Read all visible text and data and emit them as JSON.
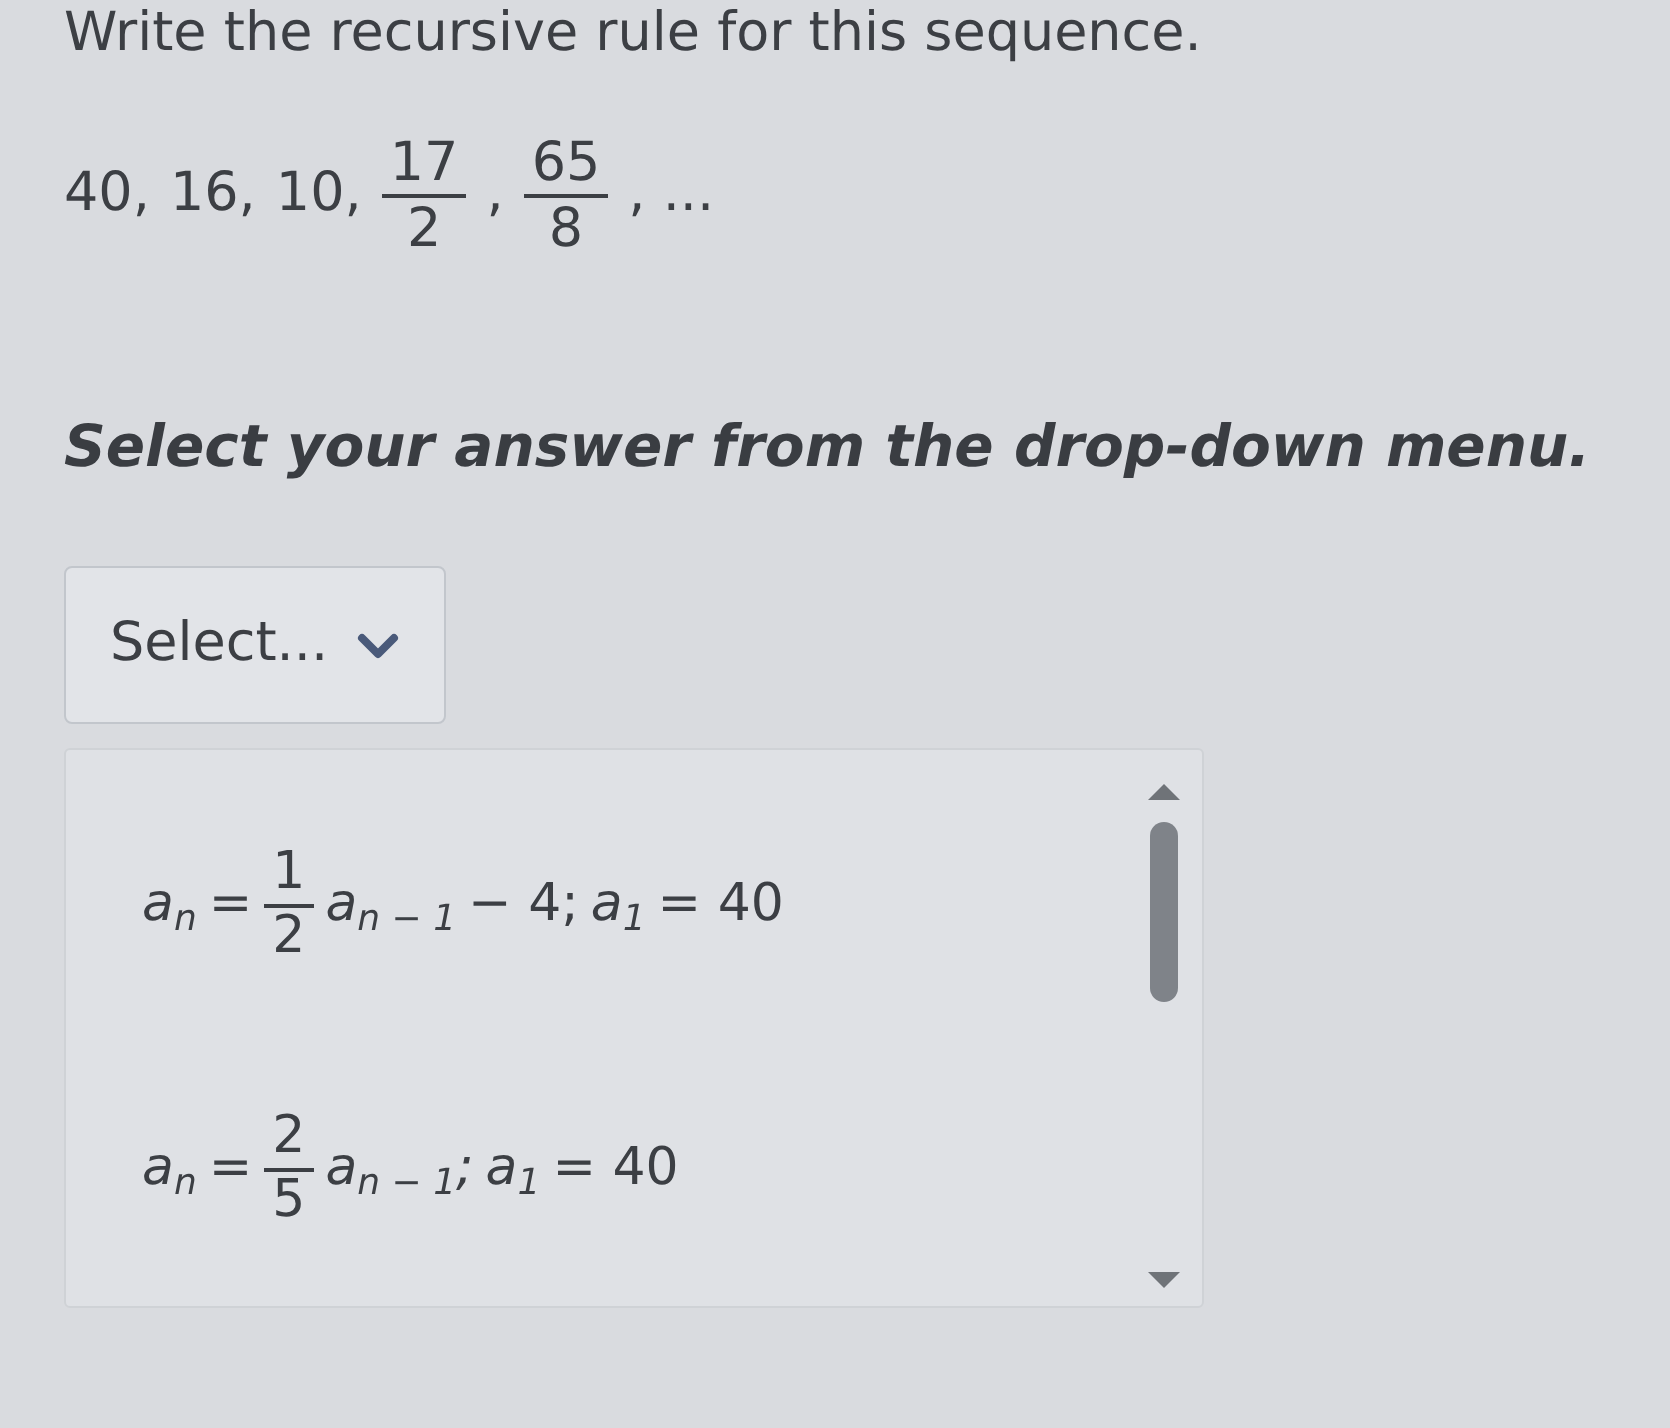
{
  "question": "Write the recursive rule for this sequence.",
  "sequence": [
    {
      "kind": "number",
      "text": "40,"
    },
    {
      "kind": "number",
      "text": "16,"
    },
    {
      "kind": "number",
      "text": "10,"
    },
    {
      "kind": "fraction",
      "numerator": "17",
      "denominator": "2"
    },
    {
      "kind": "number",
      "text": ","
    },
    {
      "kind": "fraction",
      "numerator": "65",
      "denominator": "8"
    },
    {
      "kind": "number",
      "text": ", ..."
    }
  ],
  "instruction": "Select your answer from the drop-down menu.",
  "dropdown": {
    "placeholder": "Select...",
    "expanded": true
  },
  "options": [
    {
      "selected": false,
      "parts": [
        {
          "kind": "var",
          "text": "a$_{n}$"
        },
        {
          "kind": "op",
          "text": "="
        },
        {
          "kind": "fraction",
          "numerator": "1",
          "denominator": "2"
        },
        {
          "kind": "var",
          "text": "a$_{n − 1}$"
        },
        {
          "kind": "op",
          "text": "− 4;"
        },
        {
          "kind": "var",
          "text": "a$_{1}$"
        },
        {
          "kind": "op",
          "text": "= 40"
        }
      ]
    },
    {
      "selected": false,
      "parts": [
        {
          "kind": "var",
          "text": "a$_{n}$"
        },
        {
          "kind": "op",
          "text": "="
        },
        {
          "kind": "fraction",
          "numerator": "2",
          "denominator": "5"
        },
        {
          "kind": "var",
          "text": "a$_{n − 1}$;"
        },
        {
          "kind": "var",
          "text": "a$_{1}$"
        },
        {
          "kind": "op",
          "text": "= 40"
        }
      ]
    }
  ]
}
